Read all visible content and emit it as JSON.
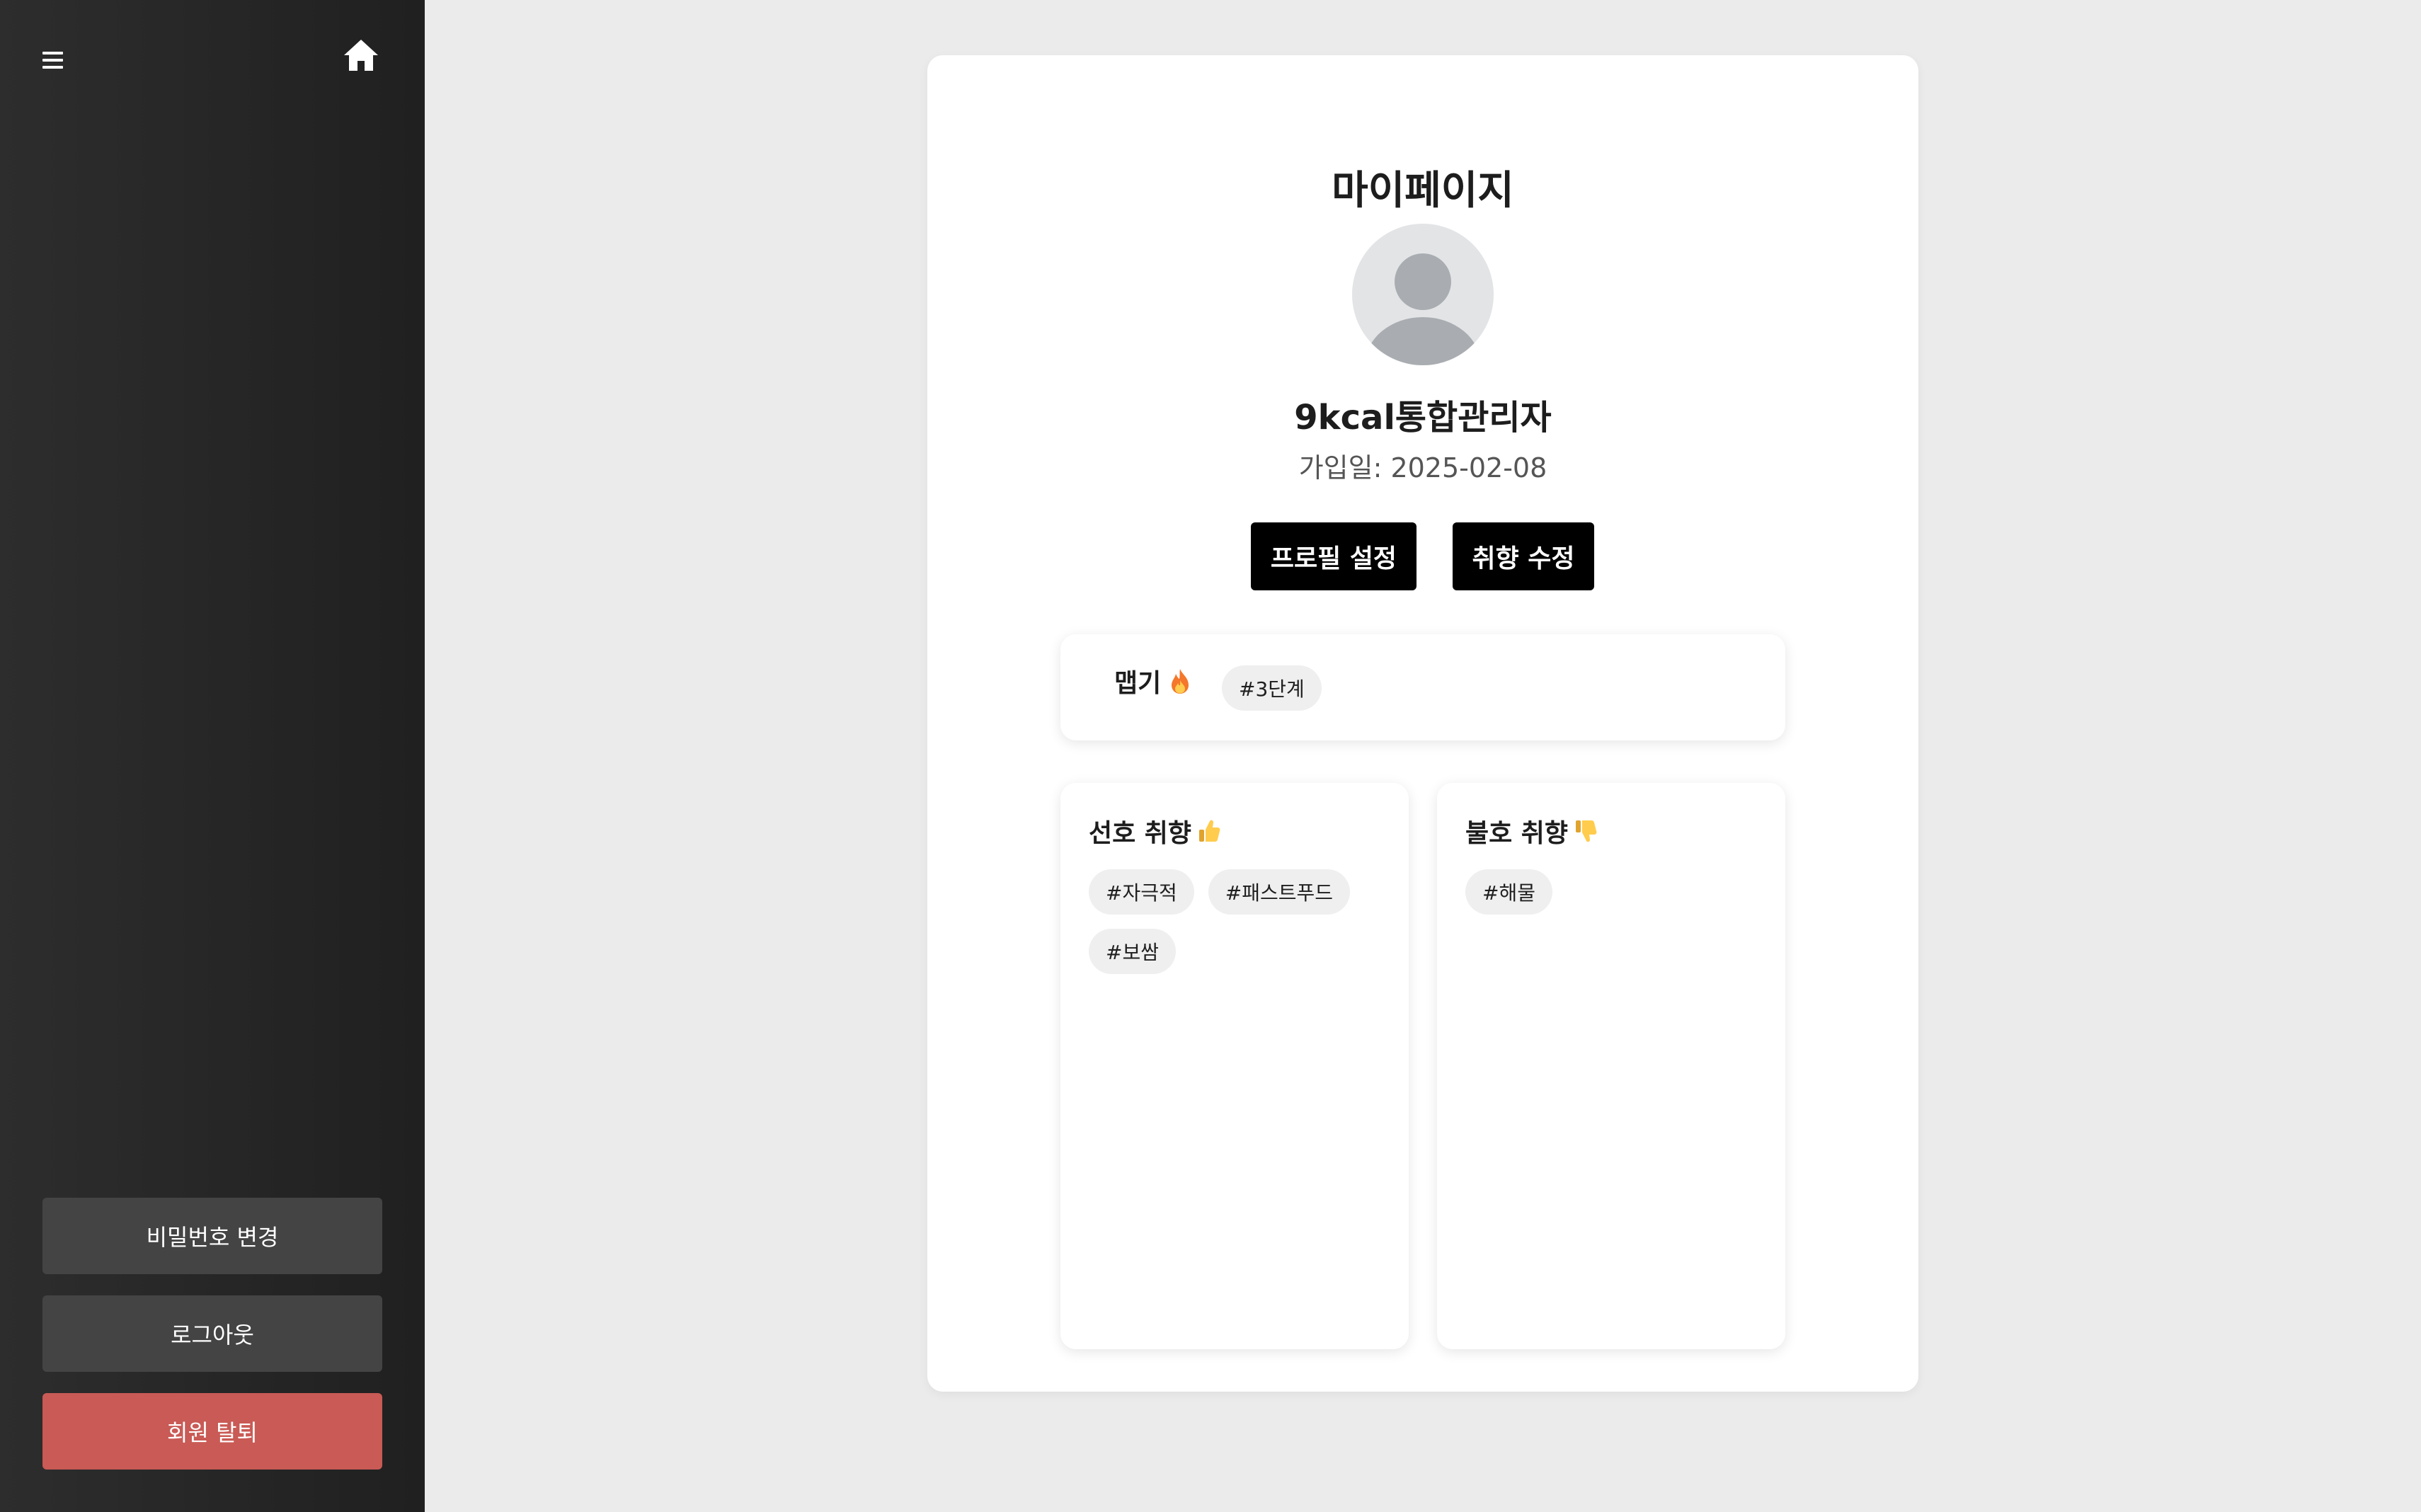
{
  "sidebar": {
    "menu_icon": "hamburger-menu-icon",
    "home_icon": "home-icon",
    "buttons": {
      "change_password": "비밀번호 변경",
      "logout": "로그아웃",
      "withdraw": "회원 탈퇴"
    }
  },
  "main": {
    "title": "마이페이지",
    "avatar_icon": "user-avatar-icon",
    "username": "9kcal통합관리자",
    "join_date": "가입일: 2025-02-08",
    "buttons": {
      "profile_settings": "프로필 설정",
      "edit_preferences": "취향 수정"
    },
    "spicy": {
      "label": "맵기",
      "icon": "fire-icon",
      "tag": "#3단계"
    },
    "likes": {
      "title": "선호 취향",
      "icon": "thumbs-up-icon",
      "tags": [
        "#자극적",
        "#패스트푸드",
        "#보쌈"
      ]
    },
    "dislikes": {
      "title": "불호 취향",
      "icon": "thumbs-down-icon",
      "tags": [
        "#해물"
      ]
    }
  },
  "colors": {
    "sidebar_bg": "#2a2a2a",
    "page_bg": "#ebebeb",
    "card_bg": "#ffffff",
    "primary_button": "#000000",
    "secondary_button": "#444444",
    "danger_button": "#c95a55",
    "tag_bg": "#efefef"
  }
}
